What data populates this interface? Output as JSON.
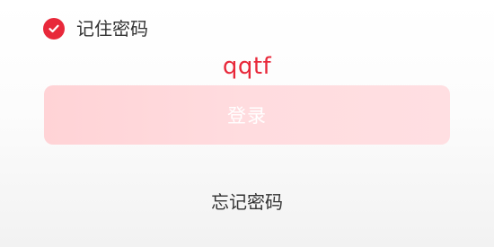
{
  "remember": {
    "label": "记住密码",
    "checked": true,
    "icon": "check-circle-icon",
    "color": "#e8283a"
  },
  "captcha": {
    "text": "qqtf",
    "color": "#e8283a"
  },
  "login": {
    "label": "登录",
    "color": "#ffd6d9"
  },
  "forgot": {
    "label": "忘记密码"
  }
}
